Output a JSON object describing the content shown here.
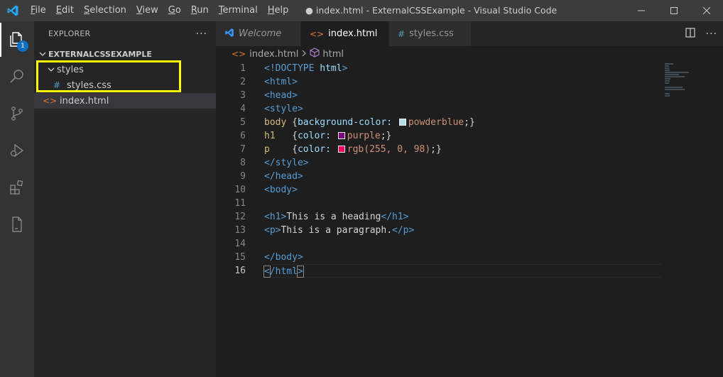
{
  "titlebar": {
    "menu": [
      {
        "label": "File",
        "u": "F",
        "rest": "ile"
      },
      {
        "label": "Edit",
        "u": "E",
        "rest": "dit"
      },
      {
        "label": "Selection",
        "u": "S",
        "rest": "election"
      },
      {
        "label": "View",
        "u": "V",
        "rest": "iew"
      },
      {
        "label": "Go",
        "u": "G",
        "rest": "o"
      },
      {
        "label": "Run",
        "u": "R",
        "rest": "un"
      },
      {
        "label": "Terminal",
        "u": "T",
        "rest": "erminal"
      },
      {
        "label": "Help",
        "u": "H",
        "rest": "elp"
      }
    ],
    "window_title": "● index.html - ExternalCSSExample - Visual Studio Code"
  },
  "activitybar": {
    "explorer_badge": "1",
    "items": [
      "files-icon",
      "search-icon",
      "source-control-icon",
      "run-debug-icon",
      "extensions-icon",
      "remote-icon"
    ]
  },
  "sidebar": {
    "header": "EXPLORER",
    "more": "···",
    "folder": "EXTERNALCSSEXAMPLE",
    "tree": {
      "styles_folder": "styles",
      "styles_css": "styles.css",
      "index_html": "index.html"
    },
    "icons": {
      "css": "#",
      "html": "<>"
    }
  },
  "tabs": [
    {
      "label": "Welcome",
      "icon": "vscode-logo-icon"
    },
    {
      "label": "index.html",
      "icon": "<>",
      "dirty": true,
      "active": true
    },
    {
      "label": "styles.css",
      "icon": "#"
    }
  ],
  "breadcrumb": {
    "file_icon": "<>",
    "file": "index.html",
    "symbol": "html"
  },
  "editor": {
    "line_numbers": [
      "1",
      "2",
      "3",
      "4",
      "5",
      "6",
      "7",
      "8",
      "9",
      "10",
      "11",
      "12",
      "13",
      "14",
      "15",
      "16"
    ],
    "current_line": 16,
    "code": {
      "l1_tag": "<!DOCTYPE",
      "l1_name": " html",
      "l1_end": ">",
      "html_open": "<html>",
      "head_open": "<head>",
      "style_open": "<style>",
      "body_sel": "body ",
      "brace_open": "{",
      "bg_prop": "background-color:",
      "bg_val": "powderblue",
      "brace_close": ";}",
      "h1_sel": "h1   ",
      "color_prop": "color:",
      "purple_val": "purple",
      "p_sel": "p    ",
      "rgb_val": "rgb(255, 0, 98)",
      "style_close": "</style>",
      "head_close": "</head>",
      "body_open": "<body>",
      "h1_open": "<h1>",
      "h1_text": "This is a heading",
      "h1_close": "</h1>",
      "p_open": "<p>",
      "p_text": "This is a paragraph.",
      "p_close": "</p>",
      "body_close": "</body>",
      "html_close_lt": "<",
      "html_close_mid": "/html",
      "html_close_gt": ">"
    },
    "swatches": {
      "powderblue": "#b0e0e6",
      "purple": "#800080",
      "rgb": "#ff0062"
    }
  },
  "colors": {
    "accent": "#0e70c0",
    "highlight_box": "#ffff00"
  }
}
